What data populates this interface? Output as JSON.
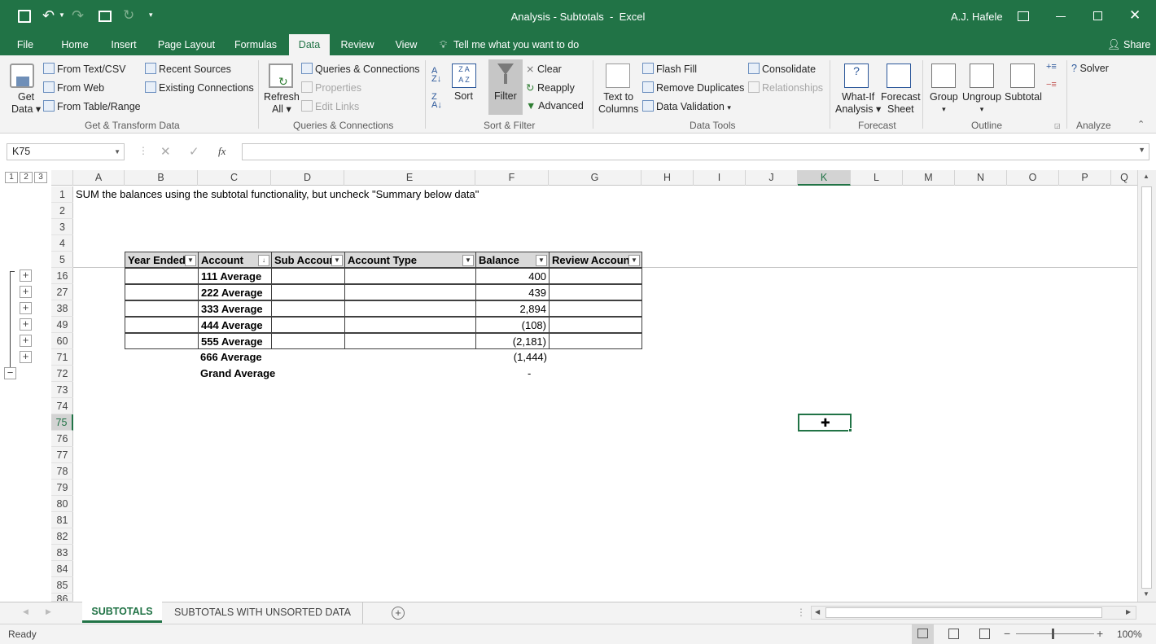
{
  "title_bar": {
    "title": "Analysis - Subtotals  -  Excel",
    "user": "A.J. Hafele"
  },
  "tabs": [
    "File",
    "Home",
    "Insert",
    "Page Layout",
    "Formulas",
    "Data",
    "Review",
    "View"
  ],
  "active_tab": "Data",
  "tell_me": "Tell me what you want to do",
  "share": "Share",
  "ribbon": {
    "get_data": [
      "Get",
      "Data"
    ],
    "from_text": "From Text/CSV",
    "from_web": "From Web",
    "from_table": "From Table/Range",
    "recent_sources": "Recent Sources",
    "existing_connections": "Existing Connections",
    "group_get_transform": "Get & Transform Data",
    "refresh_all": [
      "Refresh",
      "All"
    ],
    "queries_connections": "Queries & Connections",
    "properties": "Properties",
    "edit_links": "Edit Links",
    "group_queries": "Queries & Connections",
    "sort": "Sort",
    "filter": "Filter",
    "clear": "Clear",
    "reapply": "Reapply",
    "advanced": "Advanced",
    "group_sort_filter": "Sort & Filter",
    "text_to_columns": [
      "Text to",
      "Columns"
    ],
    "flash_fill": "Flash Fill",
    "remove_duplicates": "Remove Duplicates",
    "data_validation": "Data Validation",
    "consolidate": "Consolidate",
    "relationships": "Relationships",
    "group_data_tools": "Data Tools",
    "what_if": [
      "What-If",
      "Analysis"
    ],
    "forecast_sheet": [
      "Forecast",
      "Sheet"
    ],
    "group_forecast": "Forecast",
    "group_btn": "Group",
    "ungroup": "Ungroup",
    "subtotal": "Subtotal",
    "group_outline": "Outline",
    "solver": "Solver",
    "group_analyze": "Analyze"
  },
  "name_box": "K75",
  "fx": "fx",
  "columns": [
    "A",
    "B",
    "C",
    "D",
    "E",
    "F",
    "G",
    "H",
    "I",
    "J",
    "K",
    "L",
    "M",
    "N",
    "O",
    "P",
    "Q"
  ],
  "selected_column": "K",
  "rows": [
    "1",
    "2",
    "3",
    "4",
    "5",
    "16",
    "27",
    "38",
    "49",
    "60",
    "71",
    "72",
    "73",
    "74",
    "75",
    "76",
    "77",
    "78",
    "79",
    "80",
    "81",
    "82",
    "83",
    "84",
    "85",
    "86"
  ],
  "selected_row": "75",
  "outline_levels": [
    "1",
    "2",
    "3"
  ],
  "instruction": "SUM the balances using the subtotal functionality, but uncheck \"Summary below data\"",
  "table": {
    "headers": [
      "Year Ended",
      "Account",
      "Sub Accoun",
      "Account Type",
      "Balance",
      "Review Accoun"
    ],
    "rows": [
      {
        "account": "111 Average",
        "balance": "400"
      },
      {
        "account": "222 Average",
        "balance": "439"
      },
      {
        "account": "333 Average",
        "balance": "2,894"
      },
      {
        "account": "444 Average",
        "balance": "(108)"
      },
      {
        "account": "555 Average",
        "balance": "(2,181)"
      },
      {
        "account": "666 Average",
        "balance": "(1,444)"
      },
      {
        "account": "Grand Average",
        "balance": "-"
      }
    ]
  },
  "sheet_tabs": [
    "SUBTOTALS",
    "SUBTOTALS WITH UNSORTED DATA"
  ],
  "active_sheet": "SUBTOTALS",
  "status": "Ready",
  "zoom": "100%"
}
